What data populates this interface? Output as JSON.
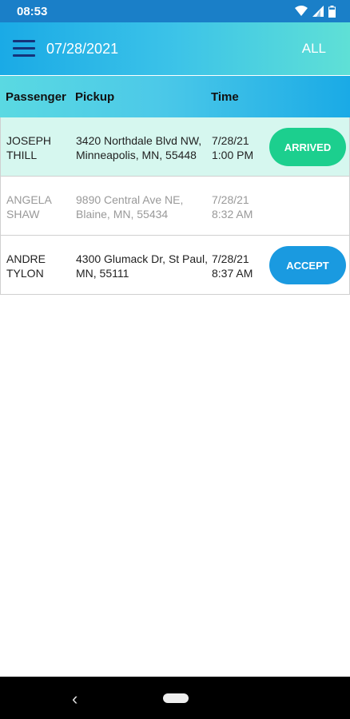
{
  "status_bar": {
    "time": "08:53"
  },
  "app_bar": {
    "date": "07/28/2021",
    "filter": "ALL"
  },
  "table": {
    "headers": {
      "passenger": "Passenger",
      "pickup": "Pickup",
      "time": "Time"
    },
    "rows": [
      {
        "name": "JOSEPH THILL",
        "pickup": "3420 Northdale Blvd NW, Minneapolis, MN, 55448",
        "time": "7/28/21 1:00 PM",
        "action": "ARRIVED",
        "action_color": "#1ccf8e",
        "row_bg": "#d6f7ef"
      },
      {
        "name": "ANGELA SHAW",
        "pickup": "9890 Central Ave NE, Blaine, MN, 55434",
        "time": "7/28/21 8:32 AM",
        "action": "",
        "row_bg": "#ffffff"
      },
      {
        "name": "ANDRE TYLON",
        "pickup": "4300 Glumack Dr, St Paul, MN, 55111",
        "time": "7/28/21 8:37 AM",
        "action": "ACCEPT",
        "action_color": "#1a9ae0",
        "row_bg": "#ffffff"
      }
    ]
  },
  "colors": {
    "status_bar": "#1a7fc8",
    "header_gradient_start": "#1aaae6",
    "header_gradient_end": "#5fe0d6",
    "menu_icon": "#15337a"
  }
}
